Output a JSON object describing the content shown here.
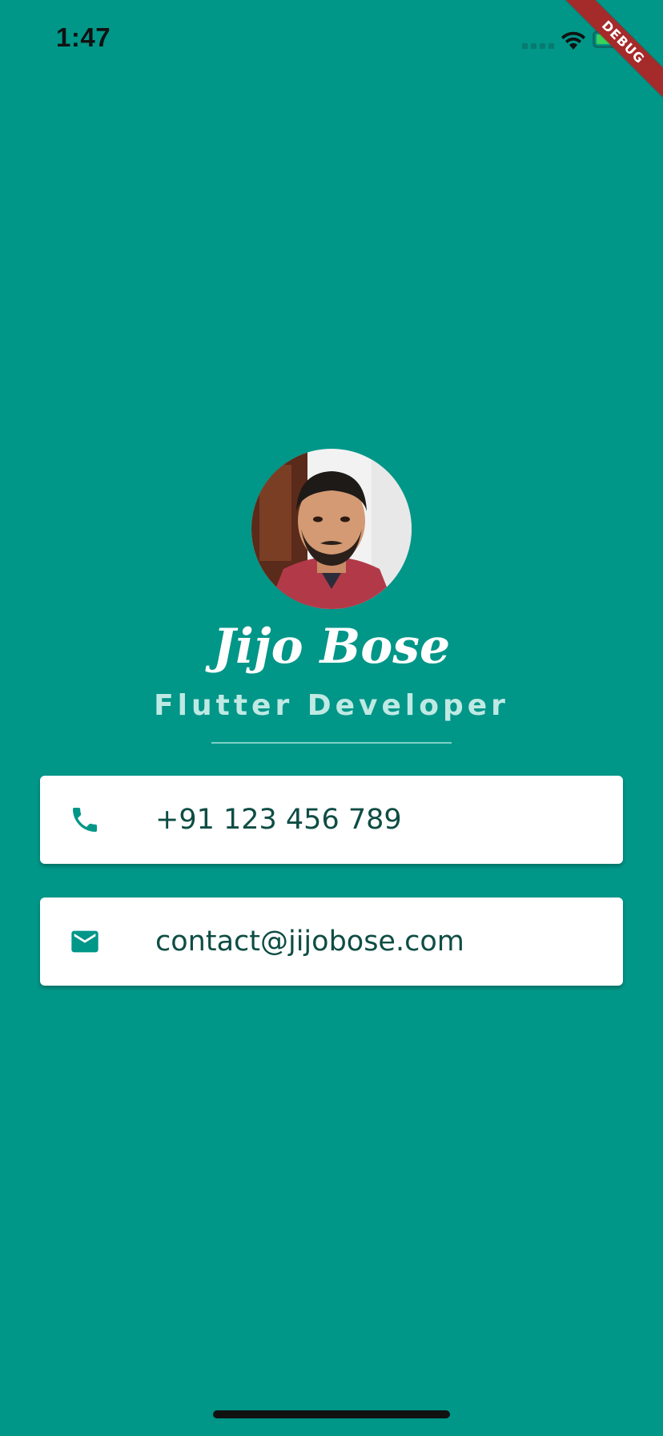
{
  "status_bar": {
    "time": "1:47",
    "icons": [
      "cellular-signal-icon",
      "wifi-icon",
      "battery-charging-icon"
    ]
  },
  "debug_banner": "DEBUG",
  "profile": {
    "name": "Jijo Bose",
    "role": "Flutter Developer"
  },
  "contacts": {
    "phone": {
      "icon": "phone-icon",
      "value": "+91 123 456 789"
    },
    "email": {
      "icon": "mail-icon",
      "value": "contact@jijobose.com"
    }
  },
  "colors": {
    "background": "#009688",
    "card": "#ffffff",
    "icon": "#009688",
    "contact_text": "#0e4d44",
    "role_text": "#bfe9e3",
    "debug_banner": "#a52a2a"
  }
}
